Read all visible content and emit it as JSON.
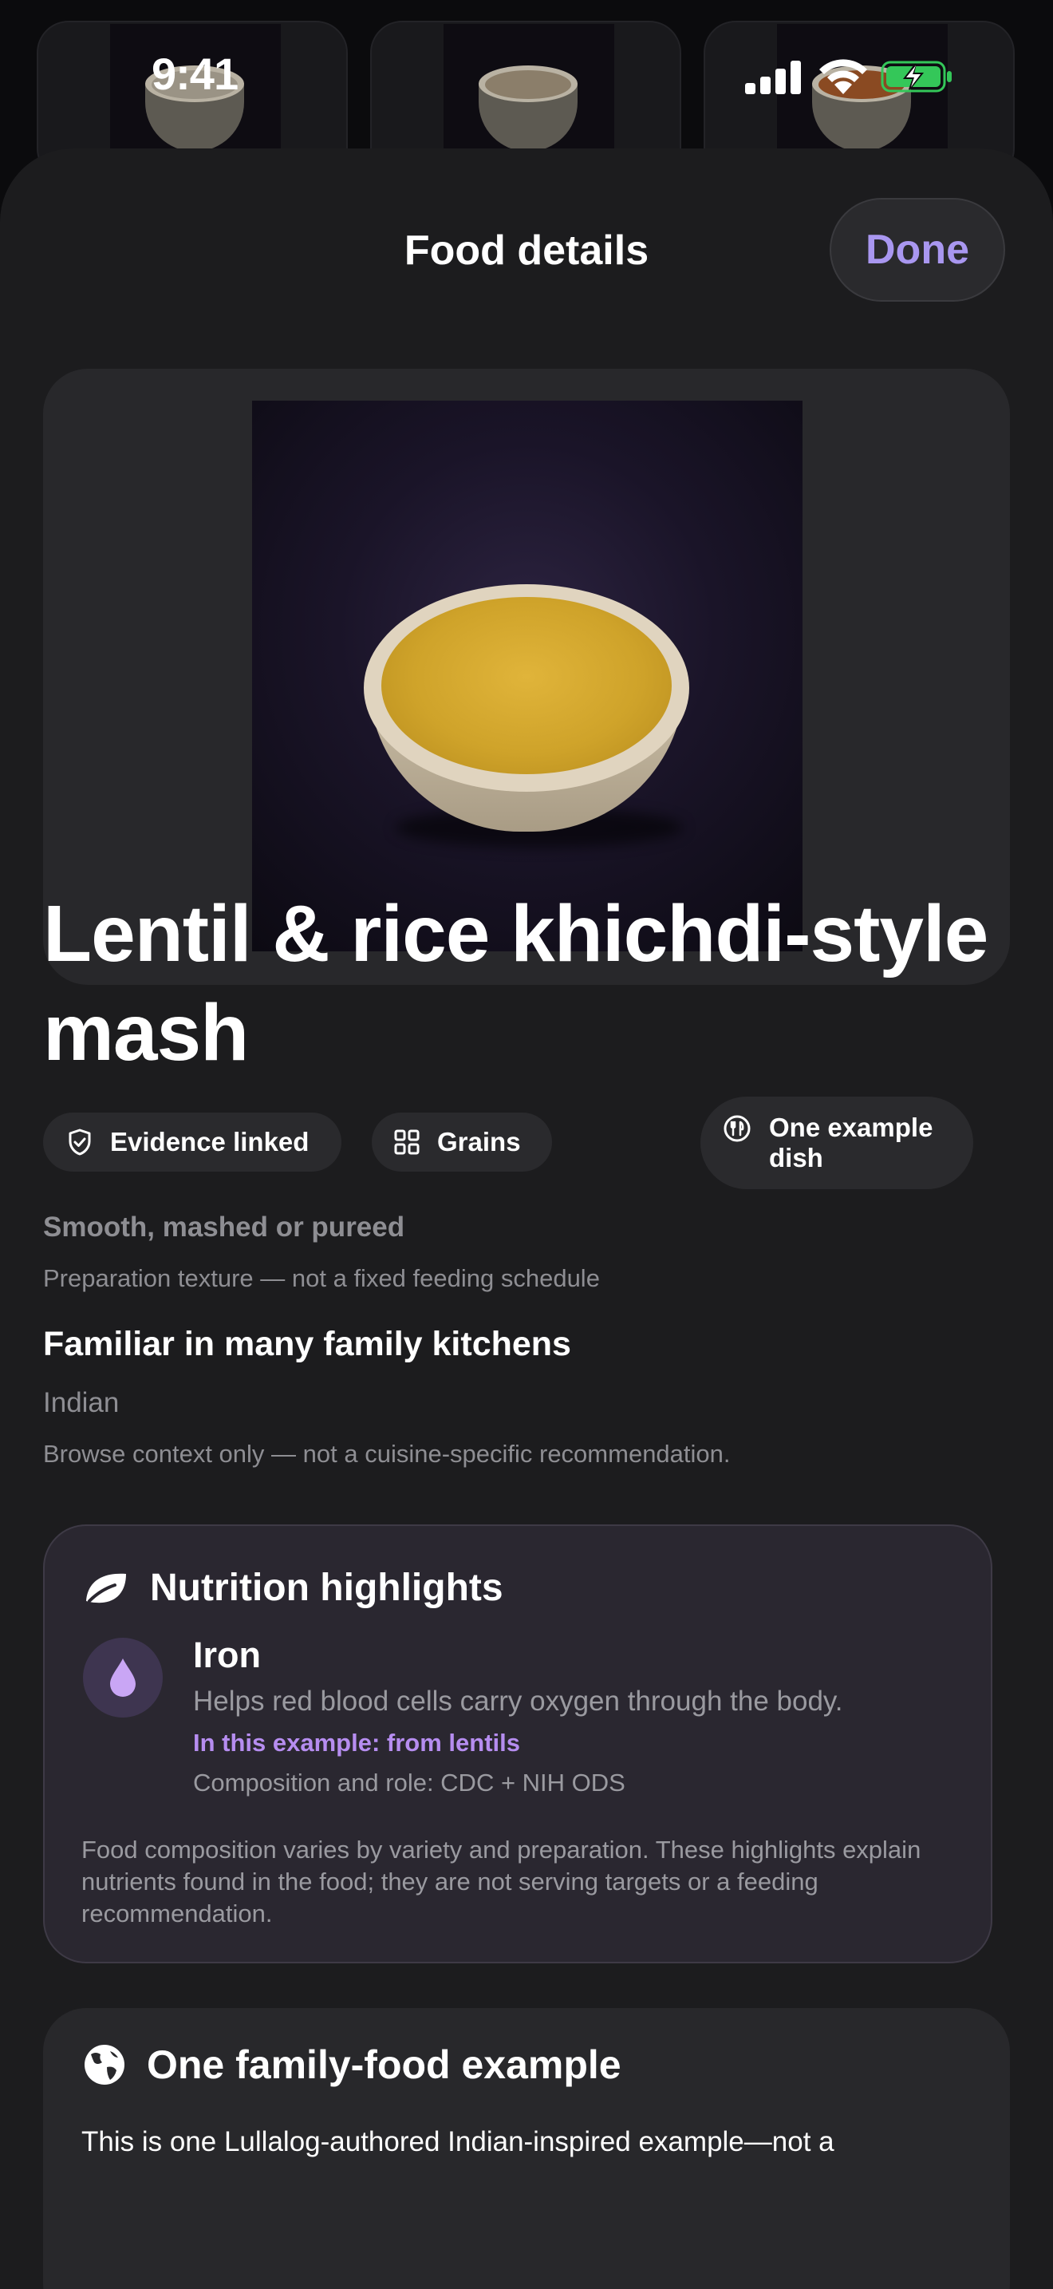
{
  "status_bar": {
    "time": "9:41"
  },
  "background_list": {
    "items": [
      {
        "food_color": "#9a9385"
      },
      {
        "food_color": "#8b7e6a"
      },
      {
        "food_color": "#8a4a22"
      }
    ]
  },
  "header": {
    "title": "Food details",
    "done_label": "Done"
  },
  "food": {
    "title": "Lentil & rice khichdi-style mash",
    "chips": {
      "evidence": "Evidence linked",
      "category": "Grains",
      "example": "One example dish"
    },
    "texture": "Smooth, mashed or pureed",
    "texture_note": "Preparation texture — not a fixed feeding schedule",
    "familiar_title": "Familiar in many family kitchens",
    "cuisine": "Indian",
    "cuisine_note": "Browse context only — not a cuisine-specific recommendation."
  },
  "nutrition": {
    "title": "Nutrition highlights",
    "nutrient": {
      "name": "Iron",
      "description": "Helps red blood cells carry oxygen through the body.",
      "source": "In this example: from lentils",
      "citation": "Composition and role: CDC + NIH ODS"
    },
    "note": "Food composition varies by variety and preparation. These highlights explain nutrients found in the food; they are not serving targets or a feeding recommendation."
  },
  "family_example": {
    "title": "One family-food example",
    "text": "This is one Lullalog-authored Indian-inspired example—not a"
  },
  "colors": {
    "accent": "#a997f0",
    "nutrient_accent": "#b68df0",
    "sheet_background": "#1c1c1e",
    "card_background": "#28282b",
    "secondary_text": "#8e8e93"
  },
  "icons": {
    "evidence": "shield-check-icon",
    "category": "grid-icon",
    "example": "utensils-icon",
    "nutrition": "leaf-icon",
    "iron": "droplet-icon",
    "family": "globe-icon"
  }
}
